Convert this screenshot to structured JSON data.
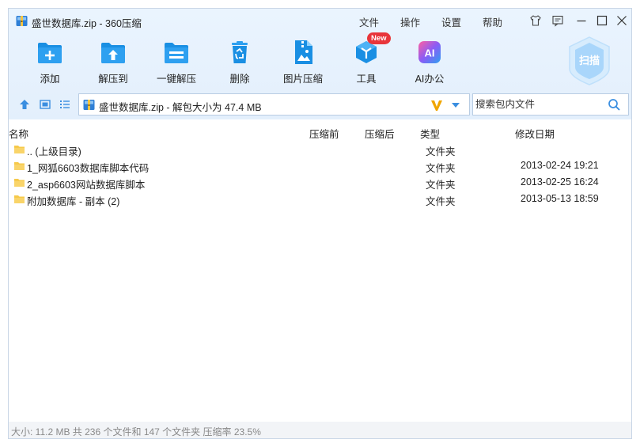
{
  "window": {
    "title": "盛世数据库.zip - 360压缩"
  },
  "menu": {
    "file": "文件",
    "operation": "操作",
    "settings": "设置",
    "help": "帮助"
  },
  "toolbar": {
    "add": "添加",
    "extract_to": "解压到",
    "one_click_extract": "一键解压",
    "delete": "删除",
    "image_compress": "图片压缩",
    "tools": "工具",
    "tools_badge": "New",
    "ai_office": "AI办公",
    "ai_icon_text": "AI",
    "scan": "扫描"
  },
  "address": {
    "path": "盛世数据库.zip - 解包大小为 47.4 MB"
  },
  "search": {
    "placeholder": "搜索包内文件"
  },
  "columns": {
    "name": "名称",
    "size_before": "压缩前",
    "size_after": "压缩后",
    "type": "类型",
    "modified": "修改日期"
  },
  "files": [
    {
      "name": ".. (上级目录)",
      "type": "文件夹",
      "date": ""
    },
    {
      "name": "1_网狐6603数据库脚本代码",
      "type": "文件夹",
      "date": "2013-02-24 19:21"
    },
    {
      "name": "2_asp6603网站数据库脚本",
      "type": "文件夹",
      "date": "2013-02-25 16:24"
    },
    {
      "name": "附加数据库 - 副本 (2)",
      "type": "文件夹",
      "date": "2013-05-13 18:59"
    }
  ],
  "status": {
    "text": "大小: 11.2 MB 共 236 个文件和 147 个文件夹 压缩率 23.5%"
  },
  "colors": {
    "accent_blue": "#1a8fe3",
    "title_bg": "#e6f1fd",
    "folder_yellow": "#f6c94a",
    "badge_red": "#e8353b"
  }
}
